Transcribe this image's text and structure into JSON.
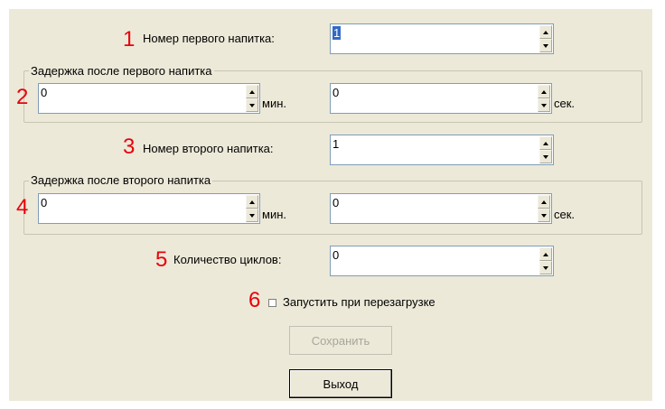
{
  "markers": [
    "1",
    "2",
    "3",
    "4",
    "5",
    "6"
  ],
  "first_drink": {
    "label": "Номер первого напитка:",
    "value": "1"
  },
  "delay_first": {
    "title": "Задержка после первого напитка",
    "minutes": "0",
    "min_unit": "мин.",
    "seconds": "0",
    "sec_unit": "сек."
  },
  "second_drink": {
    "label": "Номер второго напитка:",
    "value": "1"
  },
  "delay_second": {
    "title": "Задержка после второго напитка",
    "minutes": "0",
    "min_unit": "мин.",
    "seconds": "0",
    "sec_unit": "сек."
  },
  "cycles": {
    "label": "Количество циклов:",
    "value": "0"
  },
  "restart": {
    "label": "Запустить при перезагрузке",
    "checked": false
  },
  "buttons": {
    "save": "Сохранить",
    "save_enabled": false,
    "exit": "Выход"
  },
  "colors": {
    "marker": "#e8000c",
    "window_bg": "#ece9d8",
    "selection": "#316ac5"
  }
}
